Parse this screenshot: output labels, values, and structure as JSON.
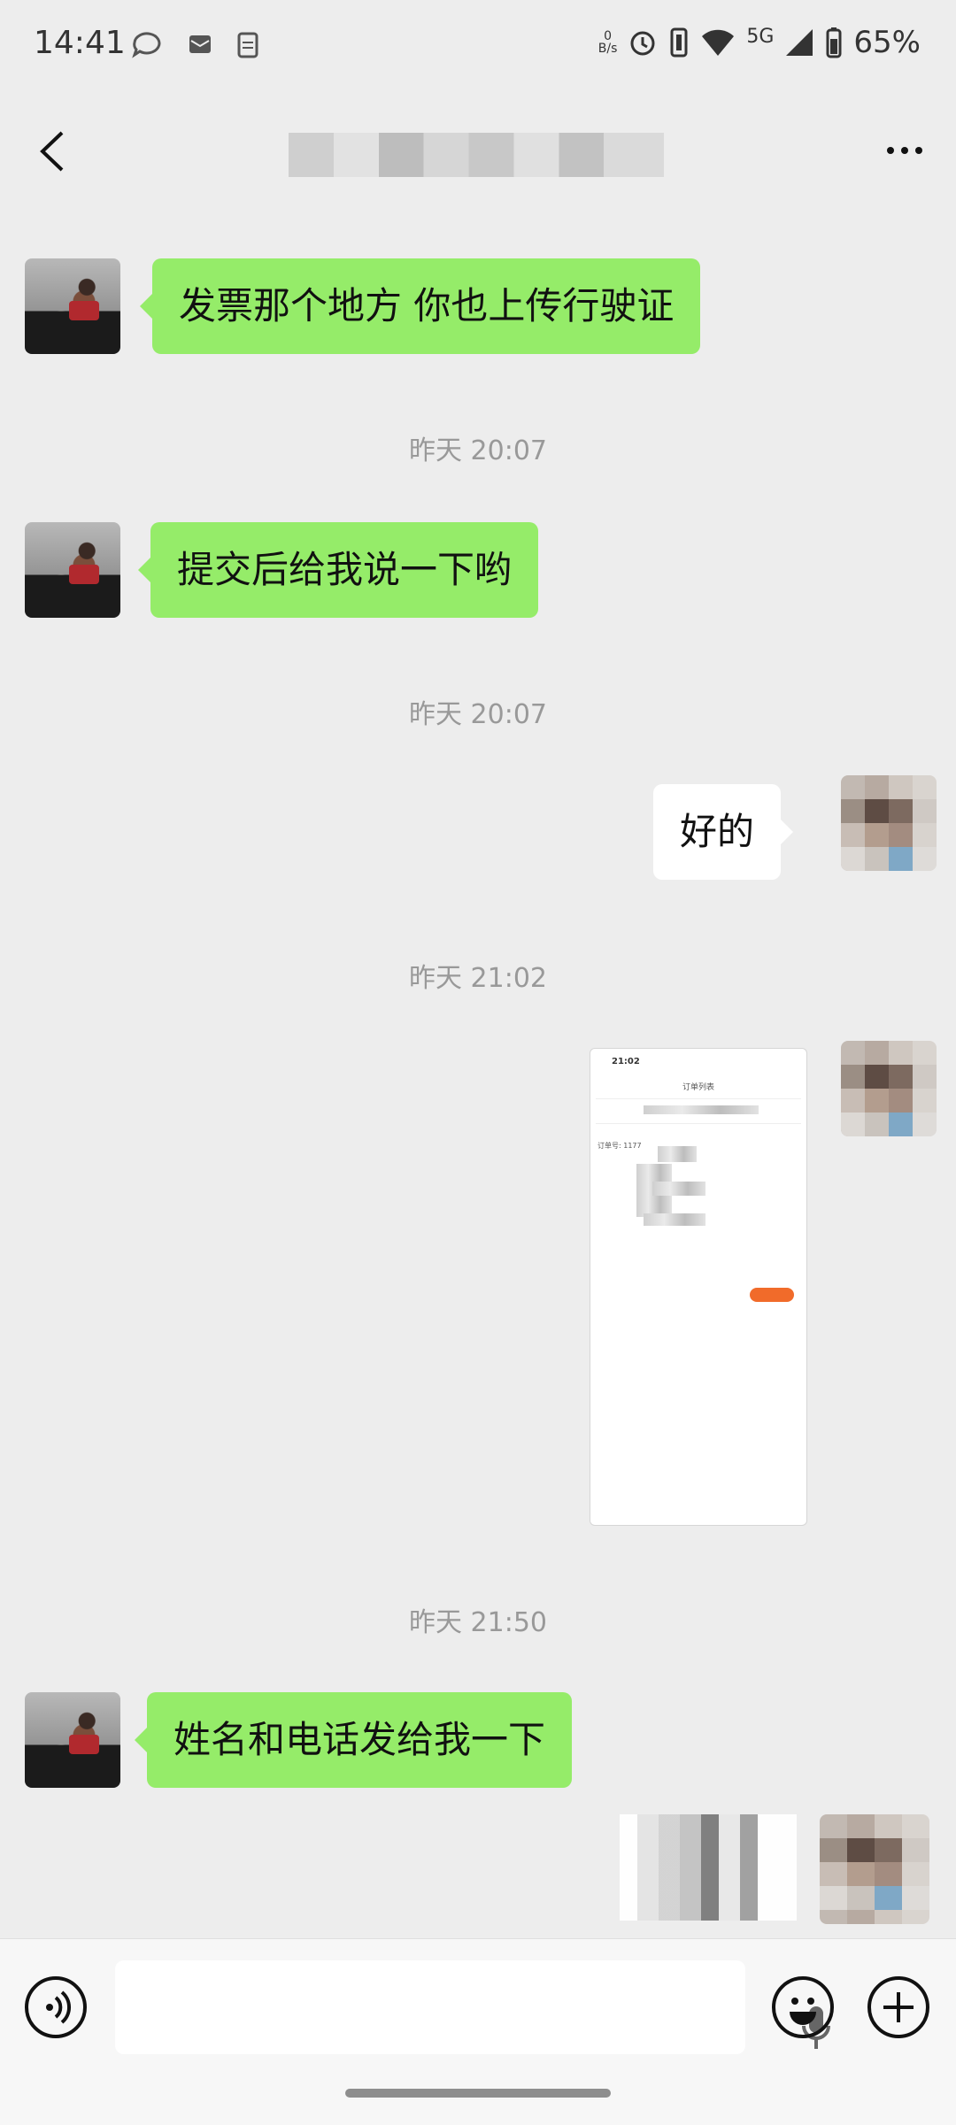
{
  "status_bar": {
    "time": "14:41",
    "network_speed": "0\nB/s",
    "network_type": "5G",
    "battery": "65%"
  },
  "header": {
    "title": "",
    "back_icon": "chevron-left-icon",
    "more_icon": "more-dots-icon"
  },
  "messages": [
    {
      "sender": "peer",
      "type": "text",
      "text": "发票那个地方 你也上传行驶证"
    },
    {
      "type": "timestamp",
      "text": "昨天 20:07"
    },
    {
      "sender": "peer",
      "type": "text",
      "text": "提交后给我说一下哟"
    },
    {
      "type": "timestamp",
      "text": "昨天 20:07"
    },
    {
      "sender": "me",
      "type": "text",
      "text": "好的"
    },
    {
      "type": "timestamp",
      "text": "昨天 21:02"
    },
    {
      "sender": "me",
      "type": "image",
      "image": {
        "time": "21:02",
        "title": "订单列表",
        "order_label": "订单号: 1177"
      }
    },
    {
      "type": "timestamp",
      "text": "昨天 21:50"
    },
    {
      "sender": "peer",
      "type": "text",
      "text": "姓名和电话发给我一下"
    },
    {
      "sender": "me",
      "type": "text",
      "text": ""
    }
  ],
  "input_bar": {
    "voice_icon": "voice-mode-icon",
    "mic_icon": "microphone-icon",
    "emoji_icon": "emoji-icon",
    "plus_icon": "plus-icon"
  },
  "colors": {
    "bg": "#ededed",
    "peer_bubble": "#95ec69",
    "self_bubble": "#ffffff",
    "accent_orange": "#f16b2a"
  }
}
